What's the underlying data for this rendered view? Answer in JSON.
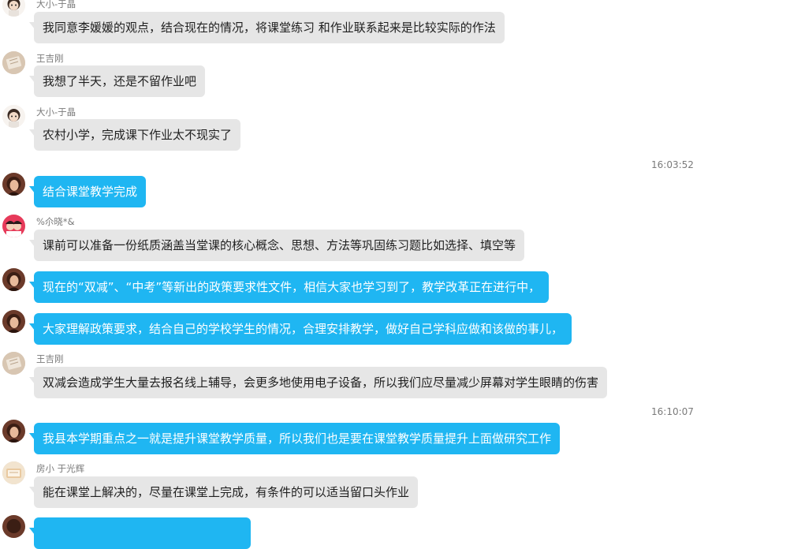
{
  "messages": [
    {
      "sender": "大小-于晶",
      "text": "我同意李媛媛的观点，结合现在的情况，将课堂练习 和作业联系起来是比较实际的作法",
      "style": "gray",
      "avatar": "girl-avatar"
    },
    {
      "sender": "王吉刚",
      "text": "我想了半天，还是不留作业吧",
      "style": "gray",
      "avatar": "book-avatar"
    },
    {
      "sender": "大小-于晶",
      "text": "农村小学，完成课下作业太不现实了",
      "style": "gray",
      "avatar": "girl-avatar"
    },
    {
      "sender": "",
      "text": "结合课堂教学完成",
      "style": "blue",
      "avatar": "woman-avatar"
    },
    {
      "sender": "%尒晓*&",
      "text": "课前可以准备一份纸质涵盖当堂课的核心概念、思想、方法等巩固练习题比如选择、填空等",
      "style": "gray",
      "avatar": "kids-avatar"
    },
    {
      "sender": "",
      "text": "现在的“双减”、“中考”等新出的政策要求性文件，相信大家也学习到了，教学改革正在进行中，",
      "style": "blue",
      "avatar": "woman-avatar"
    },
    {
      "sender": "",
      "text": "大家理解政策要求，结合自己的学校学生的情况，合理安排教学，做好自己学科应做和该做的事儿，",
      "style": "blue",
      "avatar": "woman-avatar"
    },
    {
      "sender": "王吉刚",
      "text": "双减会造成学生大量去报名线上辅导，会更多地使用电子设备，所以我们应尽量减少屏幕对学生眼睛的伤害",
      "style": "gray",
      "avatar": "book-avatar"
    },
    {
      "sender": "",
      "text": "我县本学期重点之一就是提升课堂教学质量，所以我们也是要在课堂教学质量提升上面做研究工作",
      "style": "blue",
      "avatar": "woman-avatar"
    },
    {
      "sender": "房小  于光辉",
      "text": "能在课堂上解决的，尽量在课堂上完成，有条件的可以适当留口头作业",
      "style": "gray",
      "avatar": "paper-avatar"
    }
  ],
  "timestamps": [
    "16:03:52",
    "16:10:07"
  ]
}
